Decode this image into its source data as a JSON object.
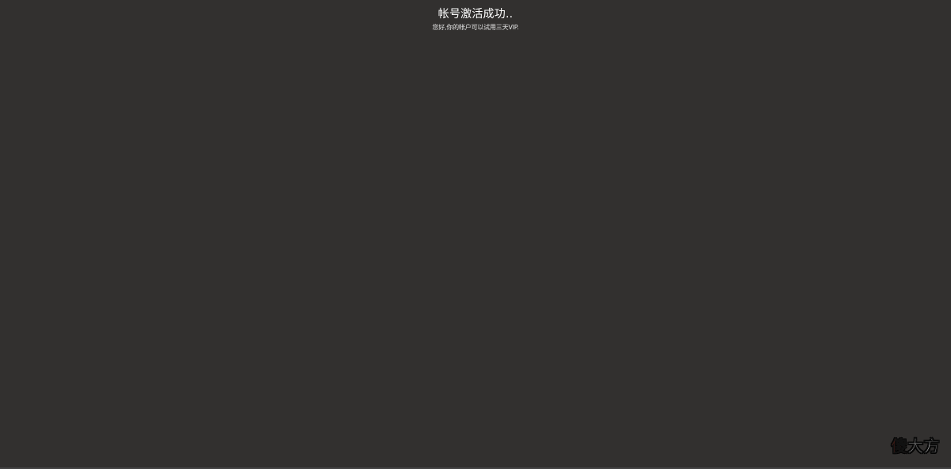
{
  "notice": {
    "title": "帐号激活成功..",
    "message": "您好,你的帐户可以试用三天VIP."
  },
  "watermark": {
    "first_char": "傻",
    "rest": "大方",
    "colors": {
      "first_char": "#ff3b1f",
      "rest": "#ffffff"
    }
  },
  "colors": {
    "background": "#32302f",
    "text": "#ffffff"
  }
}
